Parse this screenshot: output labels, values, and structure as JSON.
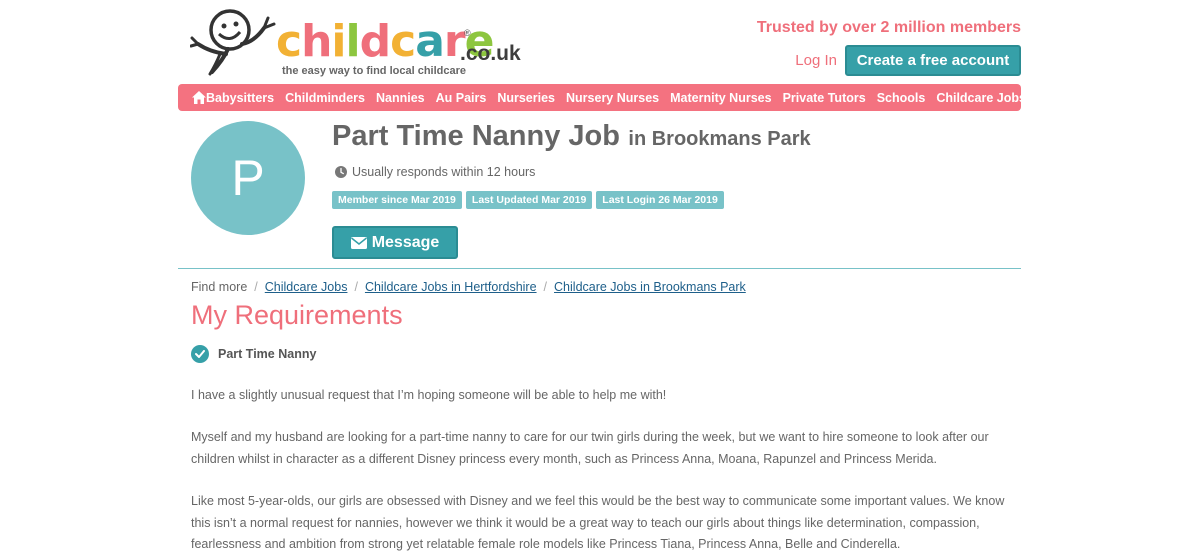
{
  "header": {
    "logo_word": [
      "c",
      "h",
      "i",
      "l",
      "d",
      "c",
      "a",
      "r",
      "e"
    ],
    "logo_colors": [
      "#f2b134",
      "#ef6f7b",
      "#f2b134",
      "#8dc63f",
      "#ef6f7b",
      "#f2b134",
      "#36a0a8",
      "#ef6f7b",
      "#8dc63f"
    ],
    "logo_domain": ".co.uk",
    "logo_reg": "®",
    "logo_tagline": "the easy way to find local childcare",
    "trusted": "Trusted by over 2 million members",
    "login": "Log In",
    "create_account": "Create a free account"
  },
  "nav": {
    "home_icon": "home-icon",
    "items": [
      "Babysitters",
      "Childminders",
      "Nannies",
      "Au Pairs",
      "Nurseries",
      "Nursery Nurses",
      "Maternity Nurses",
      "Private Tutors",
      "Schools",
      "Childcare Jobs"
    ]
  },
  "profile": {
    "avatar_letter": "P",
    "title": "Part Time Nanny Job",
    "location": "in Brookmans Park",
    "responds": "Usually responds within 12 hours",
    "badges": [
      "Member since Mar 2019",
      "Last Updated Mar 2019",
      "Last Login 26 Mar 2019"
    ],
    "message_label": "Message"
  },
  "breadcrumb": {
    "prefix": "Find more",
    "separator": "/",
    "links": [
      "Childcare Jobs",
      "Childcare Jobs in Hertfordshire",
      "Childcare Jobs in Brookmans Park"
    ]
  },
  "requirements": {
    "heading": "My Requirements",
    "item": "Part Time Nanny"
  },
  "description": [
    "I have a slightly unusual request that I’m hoping someone will be able to help me with!",
    "Myself and my husband are looking for a part-time nanny to care for our twin girls during the week, but we want to hire someone to look after our children whilst in character as a different Disney princess every month, such as Princess Anna, Moana, Rapunzel and Princess Merida.",
    "Like most 5-year-olds, our girls are obsessed with Disney and we feel this would be the best way to communicate some important values. We know this isn’t a normal request for nannies, however we think it would be a great way to teach our girls about things like determination, compassion, fearlessness and ambition from strong yet relatable female role models like Princess Tiana, Princess Anna, Belle and Cinderella."
  ],
  "colors": {
    "brand_pink": "#ef6f7b",
    "brand_teal": "#36a0a8",
    "badge_teal": "#78c2c8"
  }
}
